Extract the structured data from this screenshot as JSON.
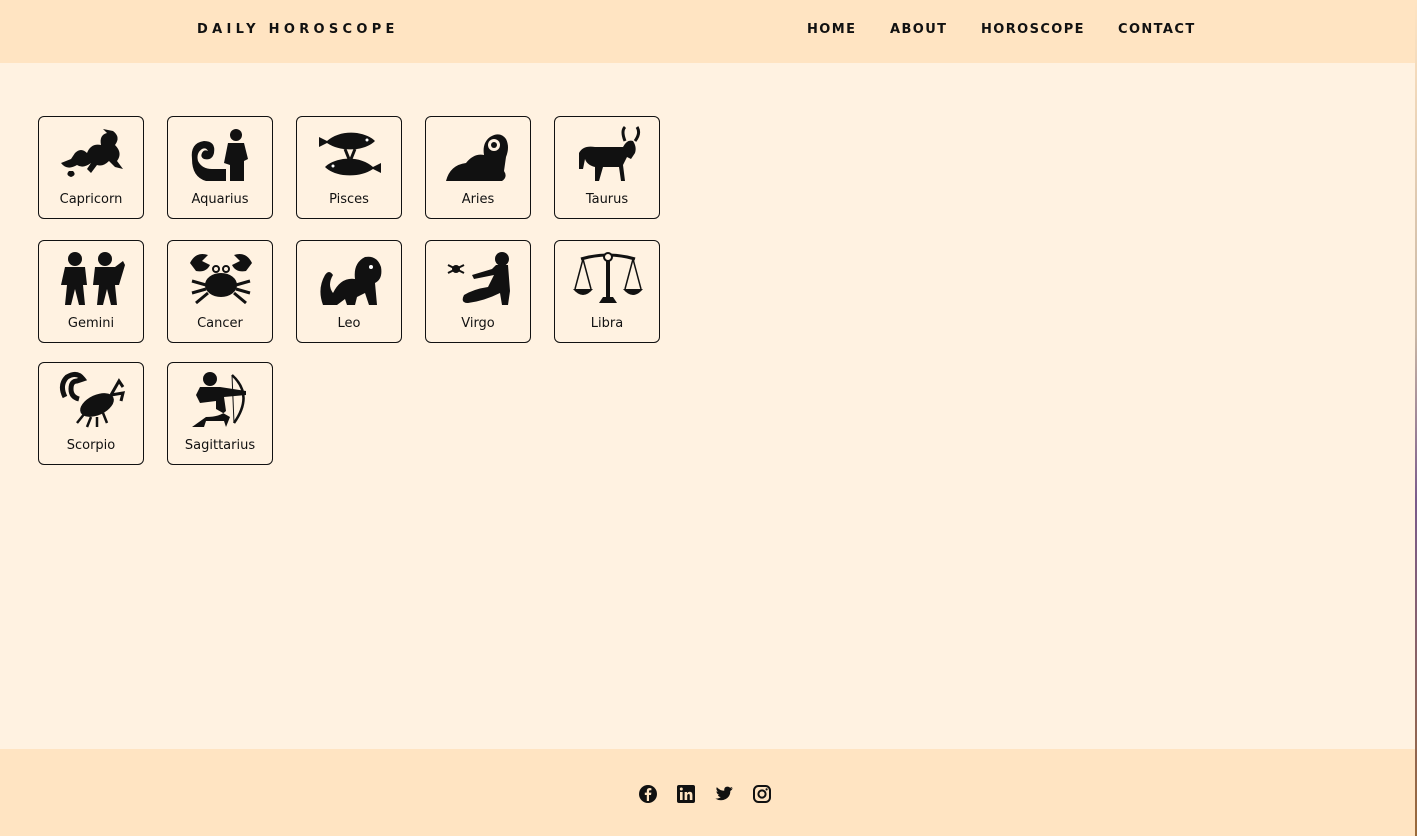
{
  "header": {
    "brand": "DAILY HOROSCOPE",
    "nav": [
      "HOME",
      "ABOUT",
      "HOROSCOPE",
      "CONTACT"
    ]
  },
  "signs": [
    {
      "label": "Capricorn",
      "icon": "capricorn-icon"
    },
    {
      "label": "Aquarius",
      "icon": "aquarius-icon"
    },
    {
      "label": "Pisces",
      "icon": "pisces-icon"
    },
    {
      "label": "Aries",
      "icon": "aries-icon"
    },
    {
      "label": "Taurus",
      "icon": "taurus-icon"
    },
    {
      "label": "Gemini",
      "icon": "gemini-icon"
    },
    {
      "label": "Cancer",
      "icon": "cancer-icon"
    },
    {
      "label": "Leo",
      "icon": "leo-icon"
    },
    {
      "label": "Virgo",
      "icon": "virgo-icon"
    },
    {
      "label": "Libra",
      "icon": "libra-icon"
    },
    {
      "label": "Scorpio",
      "icon": "scorpio-icon"
    },
    {
      "label": "Sagittarius",
      "icon": "sagittarius-icon"
    }
  ],
  "footer": {
    "social": [
      "facebook-icon",
      "linkedin-icon",
      "twitter-icon",
      "instagram-icon"
    ]
  },
  "colors": {
    "header_bg": "#ffe4c2",
    "page_bg": "#fff2e1",
    "text": "#111111"
  }
}
